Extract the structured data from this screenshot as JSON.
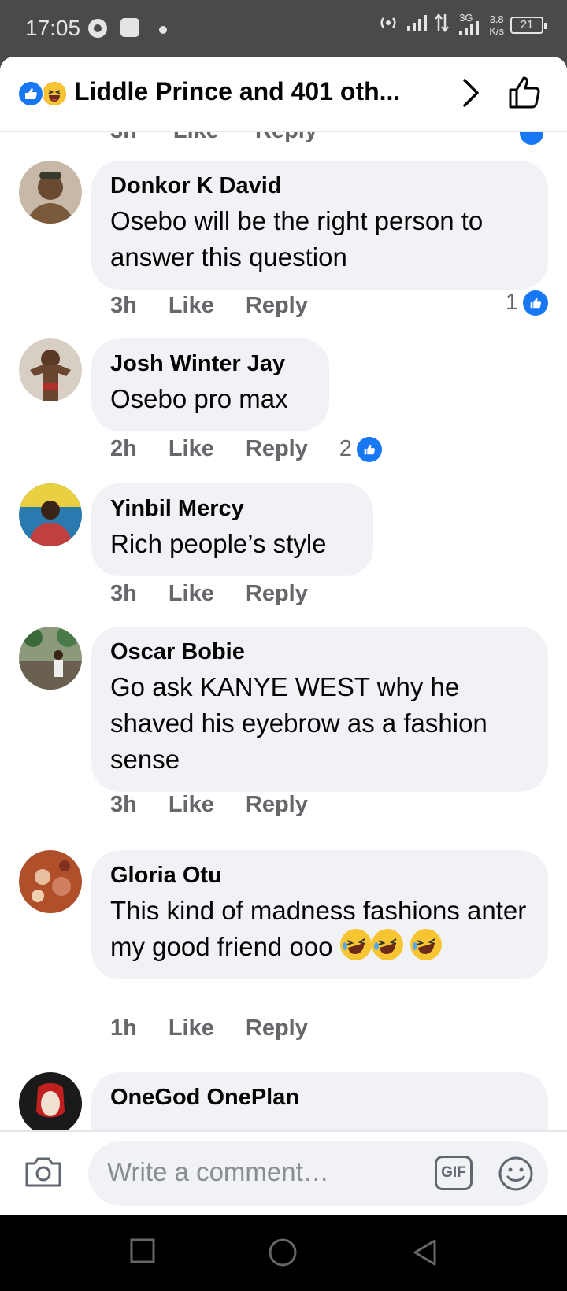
{
  "status_bar": {
    "time": "17:05",
    "network_speed_top": "3.8",
    "network_speed_unit": "K/s",
    "network_type": "3G",
    "battery": "21"
  },
  "header": {
    "title": "Liddle Prince and 401 oth...",
    "reaction_icons": [
      "like-icon",
      "haha-icon"
    ],
    "like_color": "#1877f2"
  },
  "partial_top_row": {
    "time": "3h",
    "like": "Like",
    "reply": "Reply"
  },
  "comments": [
    {
      "name": "Donkor K David",
      "text": "Osebo will be the right person to answer this question",
      "time": "3h",
      "like": "Like",
      "reply": "Reply",
      "reaction_count": "1"
    },
    {
      "name": "Josh Winter Jay",
      "text": "Osebo pro max",
      "time": "2h",
      "like": "Like",
      "reply": "Reply",
      "reaction_count": "2"
    },
    {
      "name": "Yinbil Mercy",
      "text": "Rich people’s style",
      "time": "3h",
      "like": "Like",
      "reply": "Reply"
    },
    {
      "name": "Oscar Bobie",
      "text": "Go ask KANYE WEST why he shaved his eyebrow as a fashion sense",
      "time": "3h",
      "like": "Like",
      "reply": "Reply"
    },
    {
      "name": "Gloria Otu",
      "text": "This kind of madness fashions anter my good friend ooo",
      "time": "1h",
      "like": "Like",
      "reply": "Reply"
    },
    {
      "name": "OneGod OnePlan"
    }
  ],
  "composer": {
    "placeholder": "Write a comment…",
    "gif_label": "GIF"
  }
}
